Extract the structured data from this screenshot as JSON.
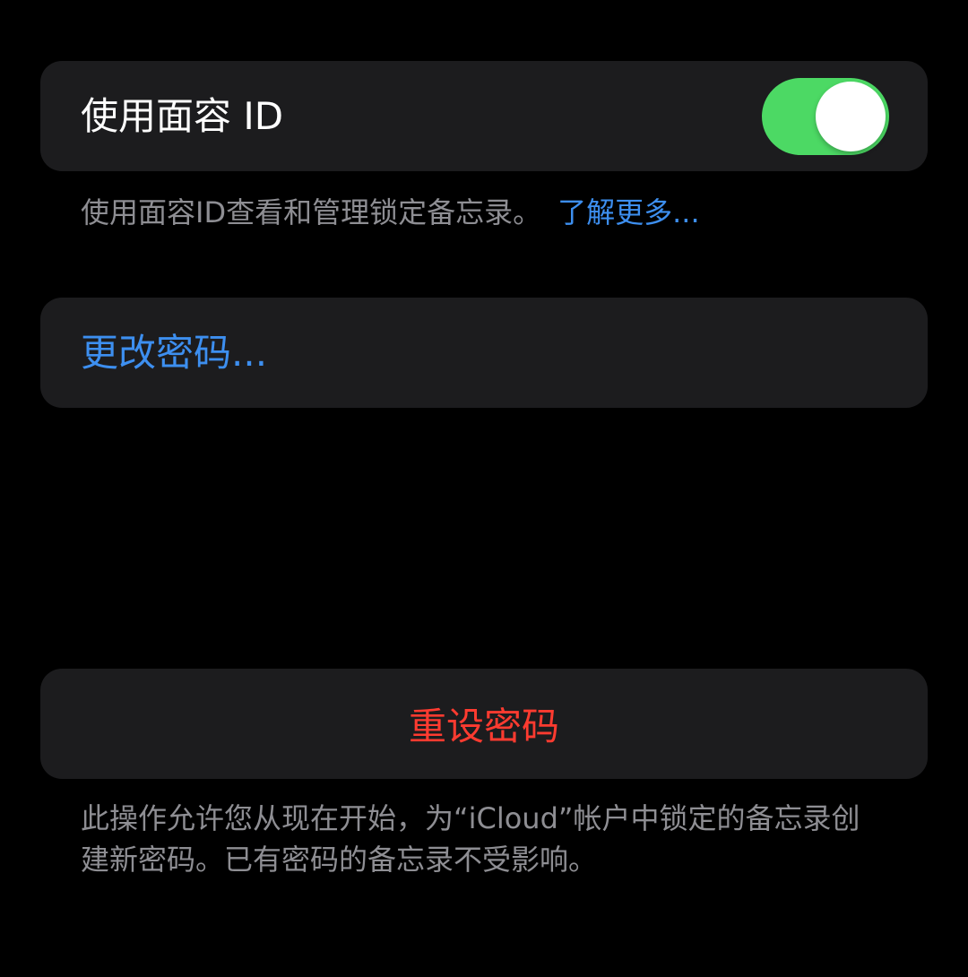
{
  "faceid": {
    "label": "使用面容 ID",
    "toggle_on": true,
    "toggle_color": "#4cd964",
    "footer": "使用面容ID查看和管理锁定备忘录。",
    "learn_more": "了解更多..."
  },
  "change_password": {
    "label": "更改密码..."
  },
  "reset_password": {
    "label": "重设密码",
    "footer": "此操作允许您从现在开始，为“iCloud”帐户中锁定的备忘录创建新密码。已有密码的备忘录不受影响。"
  },
  "colors": {
    "background": "#000000",
    "cell": "#1c1c1e",
    "link": "#3d8ff0",
    "destructive": "#ff3b30",
    "secondary_text": "#8e8e93"
  }
}
